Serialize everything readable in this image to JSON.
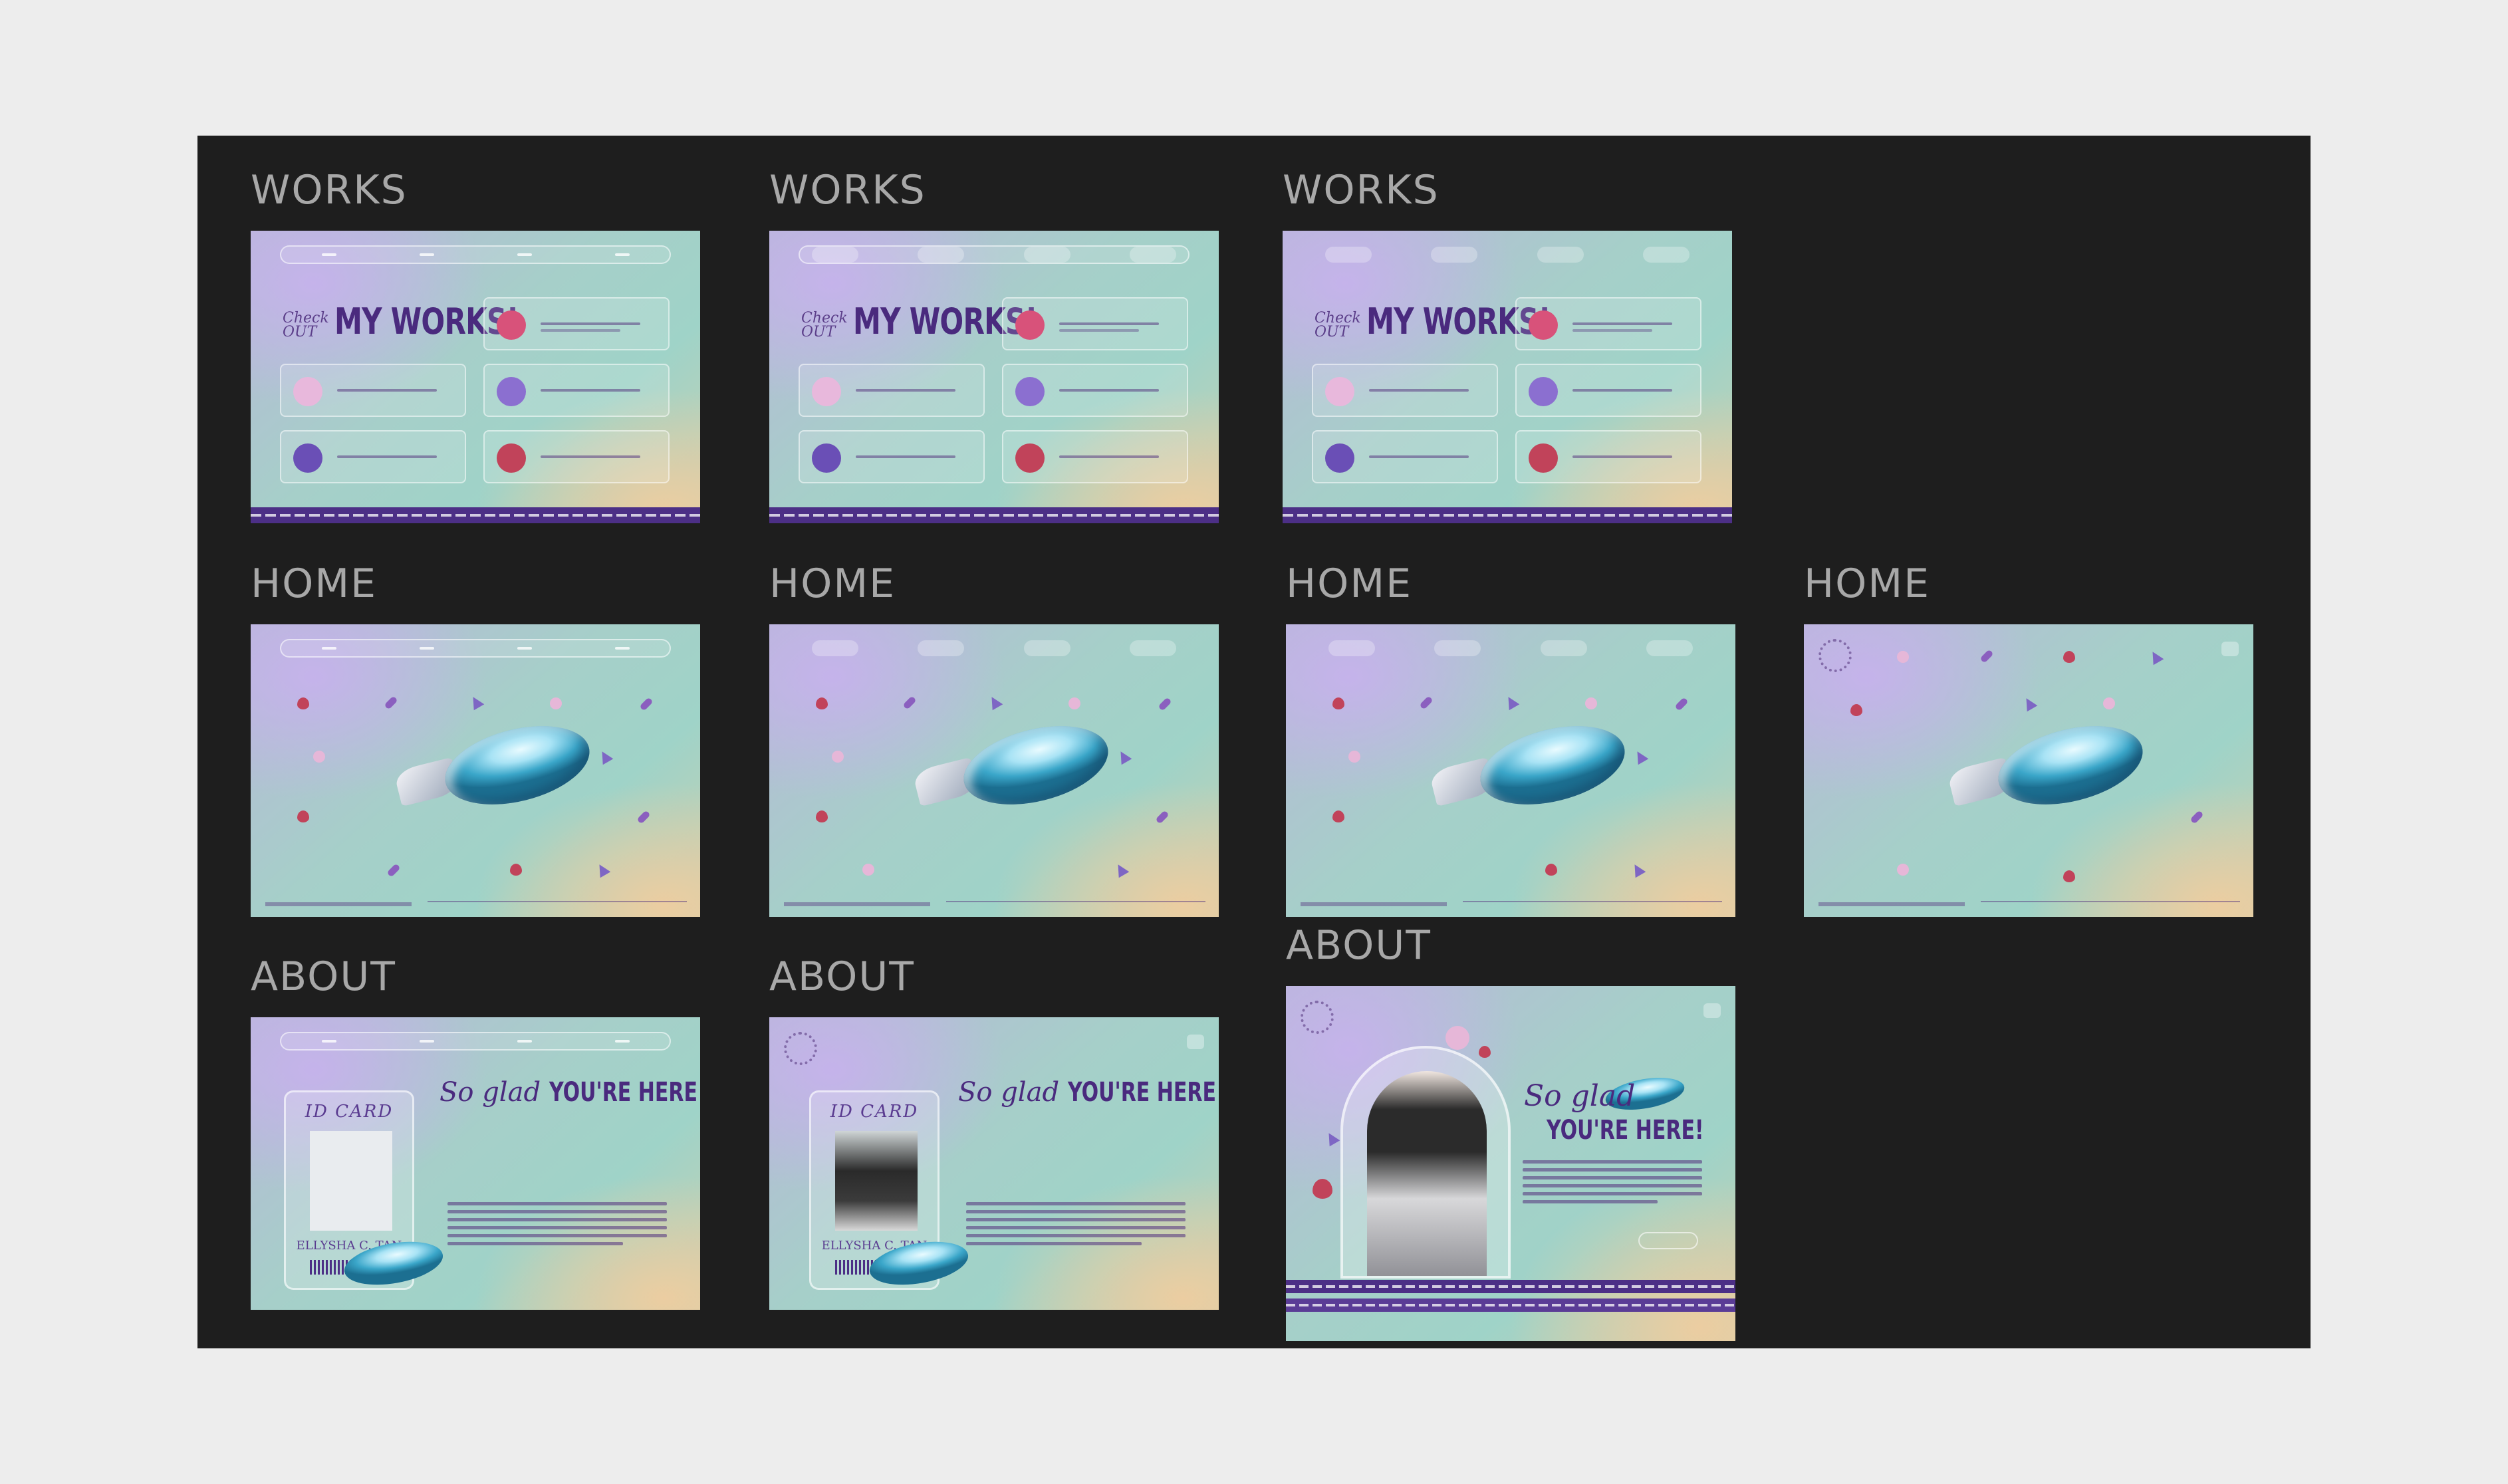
{
  "labels": {
    "works": "WORKS",
    "home": "HOME",
    "about": "ABOUT"
  },
  "works_frame": {
    "check": "Check",
    "out": "OUT",
    "title": "MY WORKS!"
  },
  "about_frame": {
    "glad": "So glad",
    "here": "YOU'RE HERE!",
    "id_card": "ID CARD",
    "name": "ELLYSHA C. TAN"
  },
  "colors": {
    "board": "#1e1e1e",
    "canvas": "#ededed",
    "accent": "#4a2a7e",
    "label": "#a8a8a8"
  }
}
